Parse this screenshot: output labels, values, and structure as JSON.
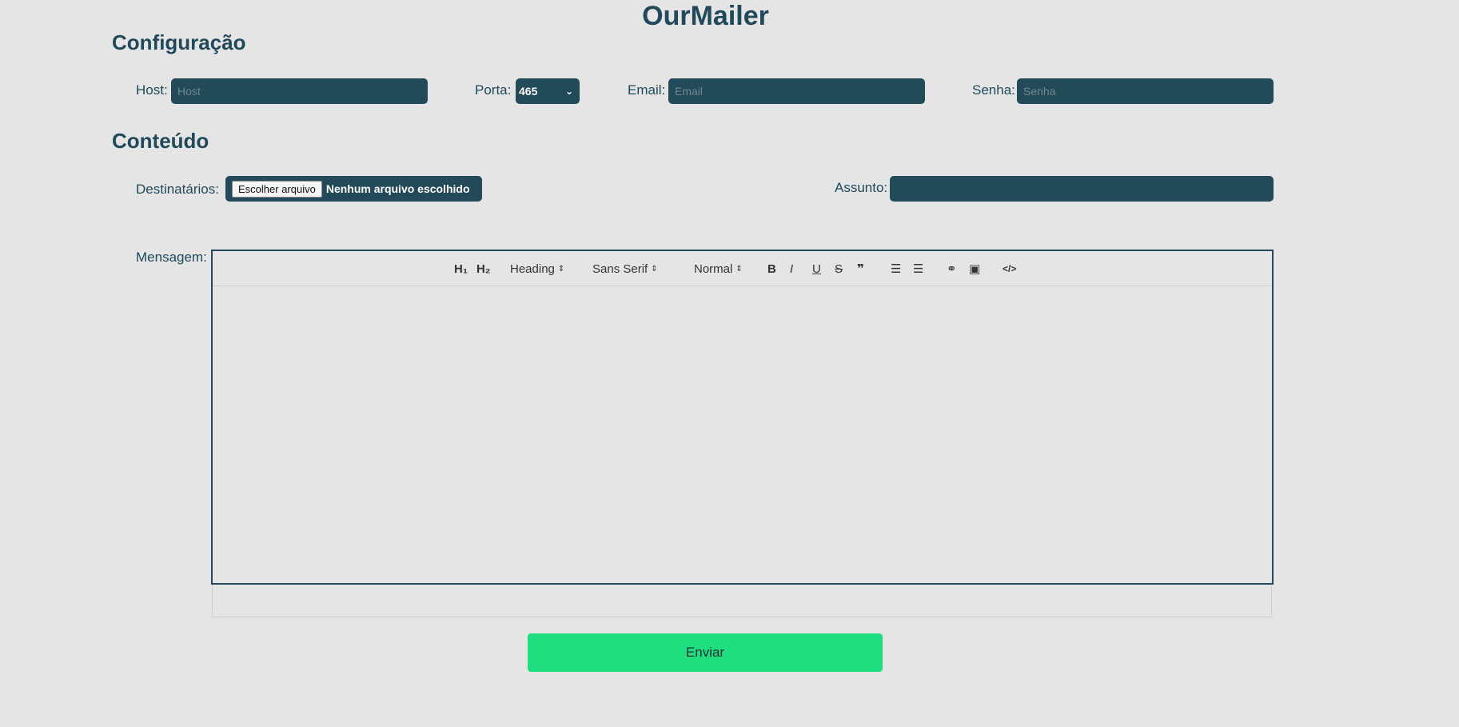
{
  "app": {
    "title": "OurMailer"
  },
  "config": {
    "title": "Configuração",
    "host_label": "Host:",
    "host_placeholder": "Host",
    "port_label": "Porta:",
    "port_value": "465",
    "email_label": "Email:",
    "email_placeholder": "Email",
    "password_label": "Senha:",
    "password_placeholder": "Senha"
  },
  "content": {
    "title": "Conteúdo",
    "recipients_label": "Destinatários:",
    "file_button": "Escolher arquivo",
    "file_status": "Nenhum arquivo escolhido",
    "subject_label": "Assunto:",
    "subject_value": "",
    "message_label": "Mensagem:"
  },
  "toolbar": {
    "h1": "H₁",
    "h2": "H₂",
    "heading": "Heading",
    "font": "Sans Serif",
    "size": "Normal",
    "bold": "B",
    "italic": "I",
    "underline": "U",
    "strike": "S",
    "quote": "❞",
    "ordered_list": "☰",
    "bullet_list": "☰",
    "link": "⚭",
    "image": "▣",
    "code": "</>"
  },
  "actions": {
    "submit": "Enviar"
  },
  "colors": {
    "primary": "#224a58",
    "submit": "#1ede80",
    "background": "#e5e5e5"
  }
}
